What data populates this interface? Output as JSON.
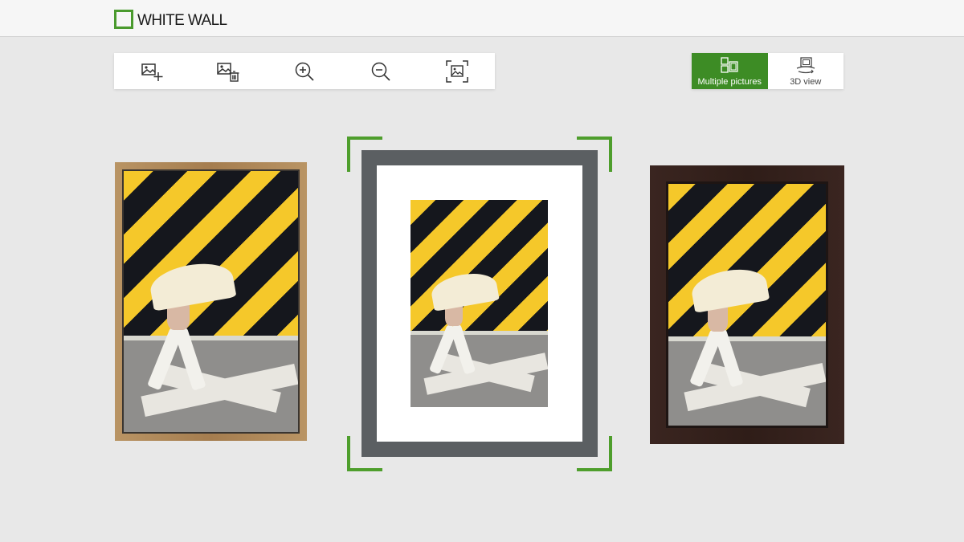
{
  "brand": {
    "name": "WHITE WALL",
    "accent_color": "#4a9a2e"
  },
  "toolbar": {
    "tools": [
      {
        "name": "add-picture",
        "icon": "image-plus-icon"
      },
      {
        "name": "delete-picture",
        "icon": "image-trash-icon"
      },
      {
        "name": "zoom-in",
        "icon": "zoom-in-icon"
      },
      {
        "name": "zoom-out",
        "icon": "zoom-out-icon"
      },
      {
        "name": "fit-to-screen",
        "icon": "image-fit-icon"
      }
    ]
  },
  "view_switch": {
    "multiple_label": "Multiple pictures",
    "three_d_label": "3D view",
    "active": "multiple",
    "active_color": "#3d8c25"
  },
  "pictures": [
    {
      "frame": "light oak wood frame",
      "frame_color": "#b08a5a",
      "selected": false
    },
    {
      "frame": "grey frame with white passe-partout",
      "frame_color": "#5b5f62",
      "selected": true
    },
    {
      "frame": "dark brown wood frame",
      "frame_color": "#33201b",
      "selected": false
    }
  ],
  "selection_color": "#4e9e2c"
}
